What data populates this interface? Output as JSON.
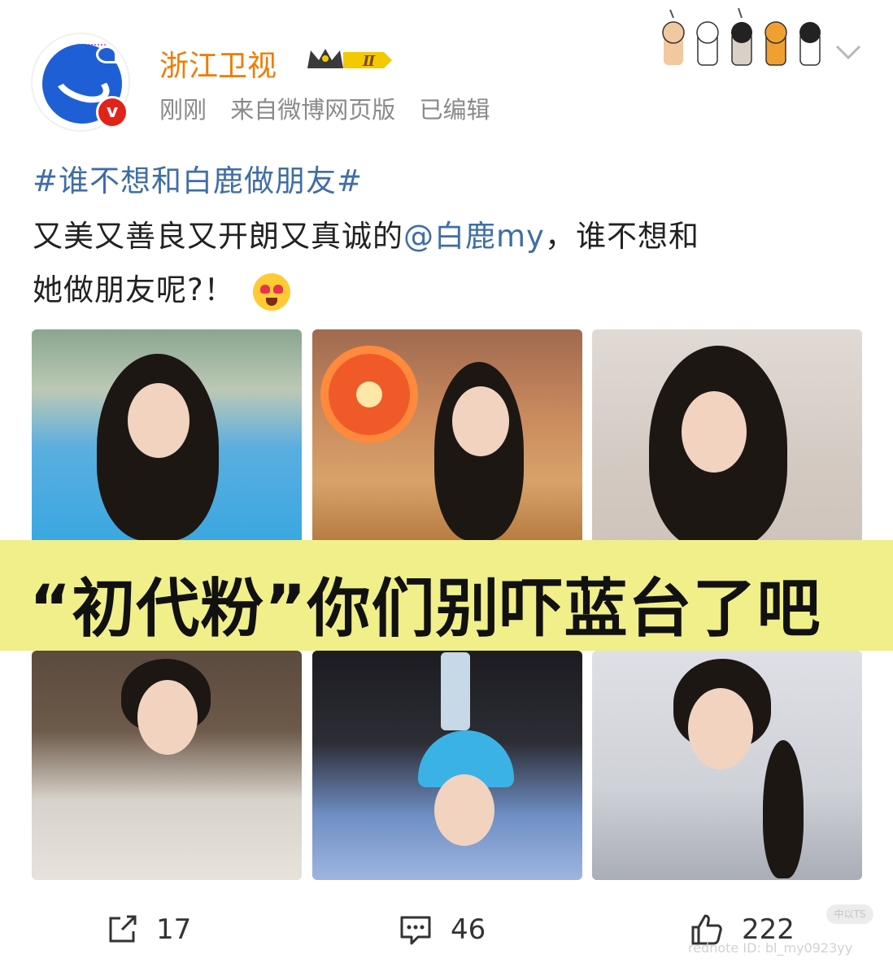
{
  "post": {
    "author": "浙江卫视",
    "level_badge": "Ⅱ",
    "time": "刚刚",
    "source": "来自微博网页版",
    "edited": "已编辑",
    "topic": "#谁不想和白鹿做朋友#",
    "text_line1_before": "又美又善良又开朗又真诚的",
    "mention": "@白鹿my",
    "text_line1_after": "，谁不想和",
    "text_line2": "她做朋友呢?！"
  },
  "caption": "“初代粉”你们别吓蓝台了吧",
  "actions": {
    "repost_count": "17",
    "comment_count": "46",
    "like_count": "222"
  },
  "watermarks": {
    "badge": "中以TS",
    "rednote": "rednote ID: bl_my0923yy"
  },
  "colors": {
    "author": "#f07b00",
    "link": "#3f6ea6",
    "banner": "#f0ef8a",
    "verified": "#e2231a"
  },
  "icons": [
    "repost-icon",
    "comment-icon",
    "like-icon",
    "chevron-down-icon",
    "verified-v-icon",
    "crown-badge-icon",
    "paw-decoration-icon"
  ]
}
